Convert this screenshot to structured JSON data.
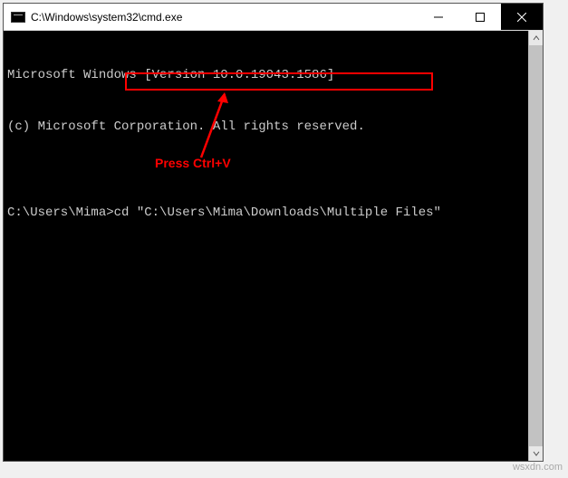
{
  "titlebar": {
    "title": "C:\\Windows\\system32\\cmd.exe"
  },
  "terminal": {
    "line1": "Microsoft Windows [Version 10.0.19043.1586]",
    "line2": "(c) Microsoft Corporation. All rights reserved.",
    "blank": "",
    "prompt": "C:\\Users\\Mima>",
    "command": "cd",
    "arg": "\"C:\\Users\\Mima\\Downloads\\Multiple Files\""
  },
  "annotation": {
    "label": "Press Ctrl+V"
  },
  "watermark": "wsxdn.com"
}
